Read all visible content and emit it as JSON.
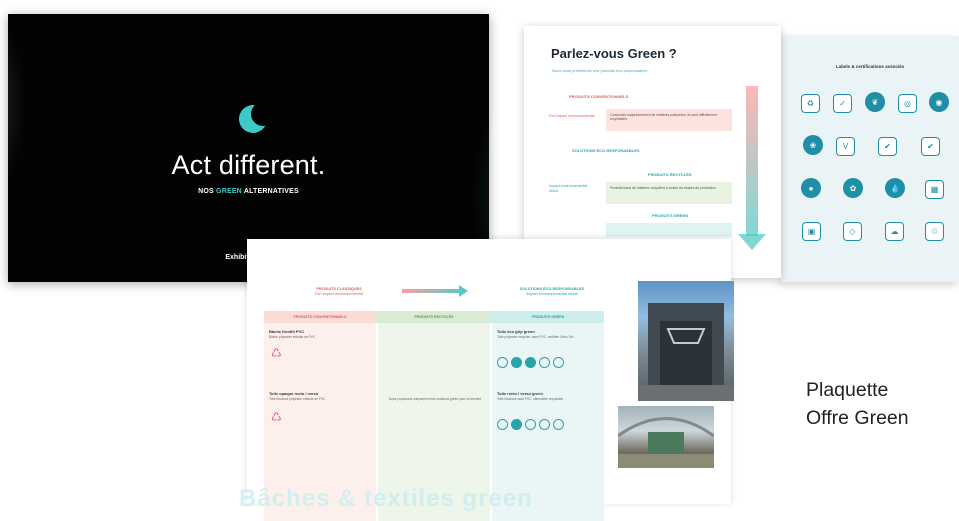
{
  "slide": {
    "title": "Act different.",
    "subtitle_pre": "NOS",
    "subtitle_green": "GREEN",
    "subtitle_post": "ALTERNATIVES",
    "brand": "Exhibit Group",
    "accent": "#3ec9c7"
  },
  "parlez": {
    "title": "Parlez-vous Green ?",
    "subtitle": "Nous vous présentons nos produits éco-responsables",
    "conventional_header": "PRODUITS CONVENTIONNELS",
    "impact_high": "Fort impact environnemental",
    "conventional_text": "Composés majoritairement de matières polluantes, ils sont difficilement recyclables.",
    "eco_header": "SOLUTIONS ÉCO-RESPONSABLES",
    "impact_low": "Impact environnemental réduit",
    "recycled_header": "PRODUITS RECYCLÉS",
    "recycled_text": "Produits issus de matières recyclées à toutes les étapes de production.",
    "green_header": "PRODUITS GREEN"
  },
  "labels": {
    "title": "Labels & certifications associés",
    "icons": [
      "recycle-icon",
      "oeko-tex-icon",
      "leaf-icon",
      "free-pvc-icon",
      "circle-label-icon",
      "fsc-icon",
      "vinyl-icon",
      "check-label-icon",
      "check-label-icon",
      "drop-icon",
      "leaf-icon",
      "drop-icon",
      "grid-icon",
      "box-icon",
      "bag-icon",
      "cloud-icon",
      "recycle-icon"
    ]
  },
  "table": {
    "left_title": "PRODUITS CLASSIQUES",
    "left_sub": "Fort impact environnemental",
    "right_title": "SOLUTIONS ÉCO-RESPONSABLES",
    "right_sub": "Impact environnemental réduit",
    "col1_header": "PRODUITS CONVENTIONNELS",
    "col2_header": "PRODUITS RECYCLÉS",
    "col3_header": "PRODUITS GREEN",
    "row1_col1_title": "Bâche frontlit PVC",
    "row1_col1_text": "Bâche polyester enduite de PVC",
    "row1_col3_title": "Toile éco grip green",
    "row1_col3_text": "Toile polyester recyclée, sans PVC, certifiée Oeko-Tex",
    "row2_col1_title": "Toile opaque recto / verso",
    "row2_col1_text": "Toile blockout polyester enduite de PVC",
    "row2_col3_title": "Toile recto / verso green",
    "row2_col3_text": "Toile blockout sans PVC, alternative recyclable",
    "col2_text": "Nous proposons uniquement des solutions green pour la moment",
    "bottom_heading": "Bâches & textiles green"
  },
  "caption": {
    "line1": "Plaquette",
    "line2": "Offre Green"
  }
}
